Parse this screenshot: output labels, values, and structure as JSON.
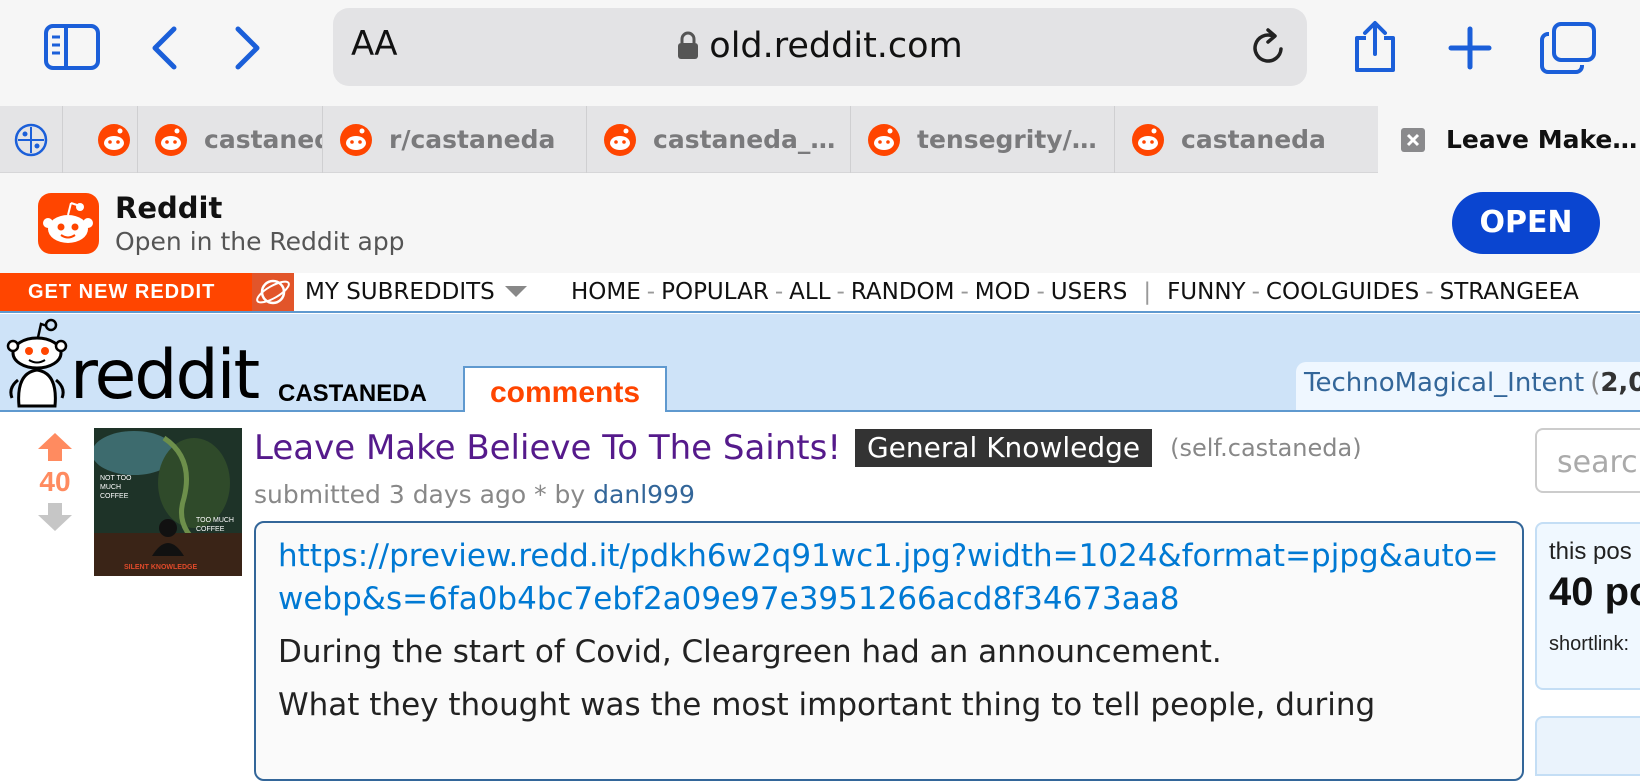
{
  "browser": {
    "address": {
      "text_size_label": "AA",
      "url": "old.reddit.com"
    },
    "tabs": [
      {
        "label": ""
      },
      {
        "label": ""
      },
      {
        "label": "castaned"
      },
      {
        "label": "r/castaneda"
      },
      {
        "label": "castaneda_…"
      },
      {
        "label": "tensegrity/…"
      },
      {
        "label": "castaneda"
      },
      {
        "label": "Leave Make…",
        "active": true
      }
    ]
  },
  "app_banner": {
    "title": "Reddit",
    "subtitle": "Open in the Reddit app",
    "open_label": "OPEN"
  },
  "nav": {
    "get_new_label": "GET NEW REDDIT",
    "my_subreddits_label": "MY SUBREDDITS",
    "links": [
      "HOME",
      "POPULAR",
      "ALL",
      "RANDOM",
      "MOD",
      "USERS"
    ],
    "favorites": [
      "FUNNY",
      "COOLGUIDES",
      "STRANGEEA"
    ]
  },
  "header": {
    "wordmark": "reddit",
    "subreddit": "CASTANEDA",
    "active_tab": "comments",
    "user": "TechnoMagical_Intent",
    "karma_partial": "2,0"
  },
  "post": {
    "score": "40",
    "title": "Leave Make Believe To The Saints!",
    "flair": "General Knowledge",
    "domain": "(self.castaneda)",
    "tagline_prefix": "submitted 3 days ago * by",
    "author": "danl999",
    "thumbnail": {
      "text_top": "NOT TOO MUCH COFFEE",
      "text_right": "TOO MUCH COFFEE",
      "text_bottom": "SILENT KNOWLEDGE"
    },
    "body_link": "https://preview.redd.it/pdkh6w2q91wc1.jpg?width=1024&format=pjpg&auto=webp&s=6fa0b4bc7ebf2a09e97e3951266acd8f34673aa8",
    "paragraphs": [
      "During the start of Covid, Cleargreen had an announcement.",
      "What they thought was the most important thing to tell people, during"
    ]
  },
  "sidebar": {
    "search_placeholder": "searc",
    "linkinfo_text": "this pos",
    "points": "40 po",
    "shortlink_label": "shortlink:"
  },
  "colors": {
    "reddit_orange": "#ff4500",
    "header_blue": "#cee3f8",
    "open_button": "#0a45d0",
    "title_visited": "#551a8b",
    "link_blue": "#0079d3"
  }
}
